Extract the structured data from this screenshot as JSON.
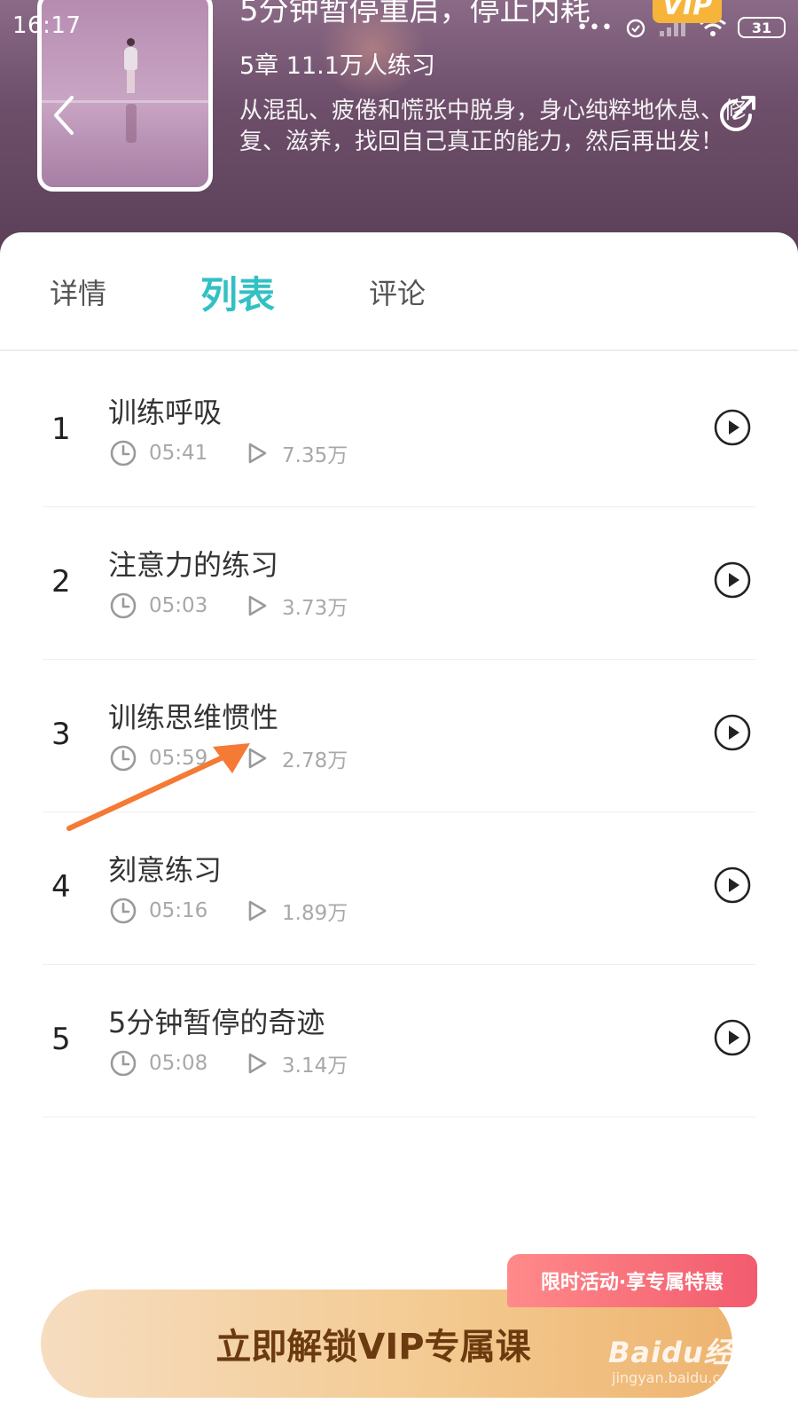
{
  "status_bar": {
    "time": "16:17",
    "battery": "31",
    "dots": "•••"
  },
  "course": {
    "title": "5分钟暂停重启，停止内耗",
    "vip_badge": "VIP",
    "meta": "5章 11.1万人练习",
    "description": "从混乱、疲倦和慌张中脱身，身心纯粹地休息、修复、滋养，找回自己真正的能力，然后再出发！"
  },
  "tabs": [
    {
      "label": "详情",
      "active": false
    },
    {
      "label": "列表",
      "active": true
    },
    {
      "label": "评论",
      "active": false
    }
  ],
  "lessons": [
    {
      "num": "1",
      "title": "训练呼吸",
      "duration": "05:41",
      "plays": "7.35万"
    },
    {
      "num": "2",
      "title": "注意力的练习",
      "duration": "05:03",
      "plays": "3.73万"
    },
    {
      "num": "3",
      "title": "训练思维惯性",
      "duration": "05:59",
      "plays": "2.78万"
    },
    {
      "num": "4",
      "title": "刻意练习",
      "duration": "05:16",
      "plays": "1.89万"
    },
    {
      "num": "5",
      "title": "5分钟暂停的奇迹",
      "duration": "05:08",
      "plays": "3.14万"
    }
  ],
  "cta": {
    "label": "立即解锁VIP专属课",
    "promo": "限时活动·享专属特惠"
  },
  "watermark": {
    "logo": "Baidu经验",
    "url": "jingyan.baidu.com"
  },
  "colors": {
    "accent": "#33c0c3",
    "annotation_arrow": "#f47a35",
    "vip": "#f6b53a"
  },
  "icons": [
    "back-icon",
    "share-icon",
    "clock-icon",
    "play-count-icon",
    "play-circle-icon",
    "wifi-icon",
    "signal-icon",
    "alarm-icon"
  ]
}
